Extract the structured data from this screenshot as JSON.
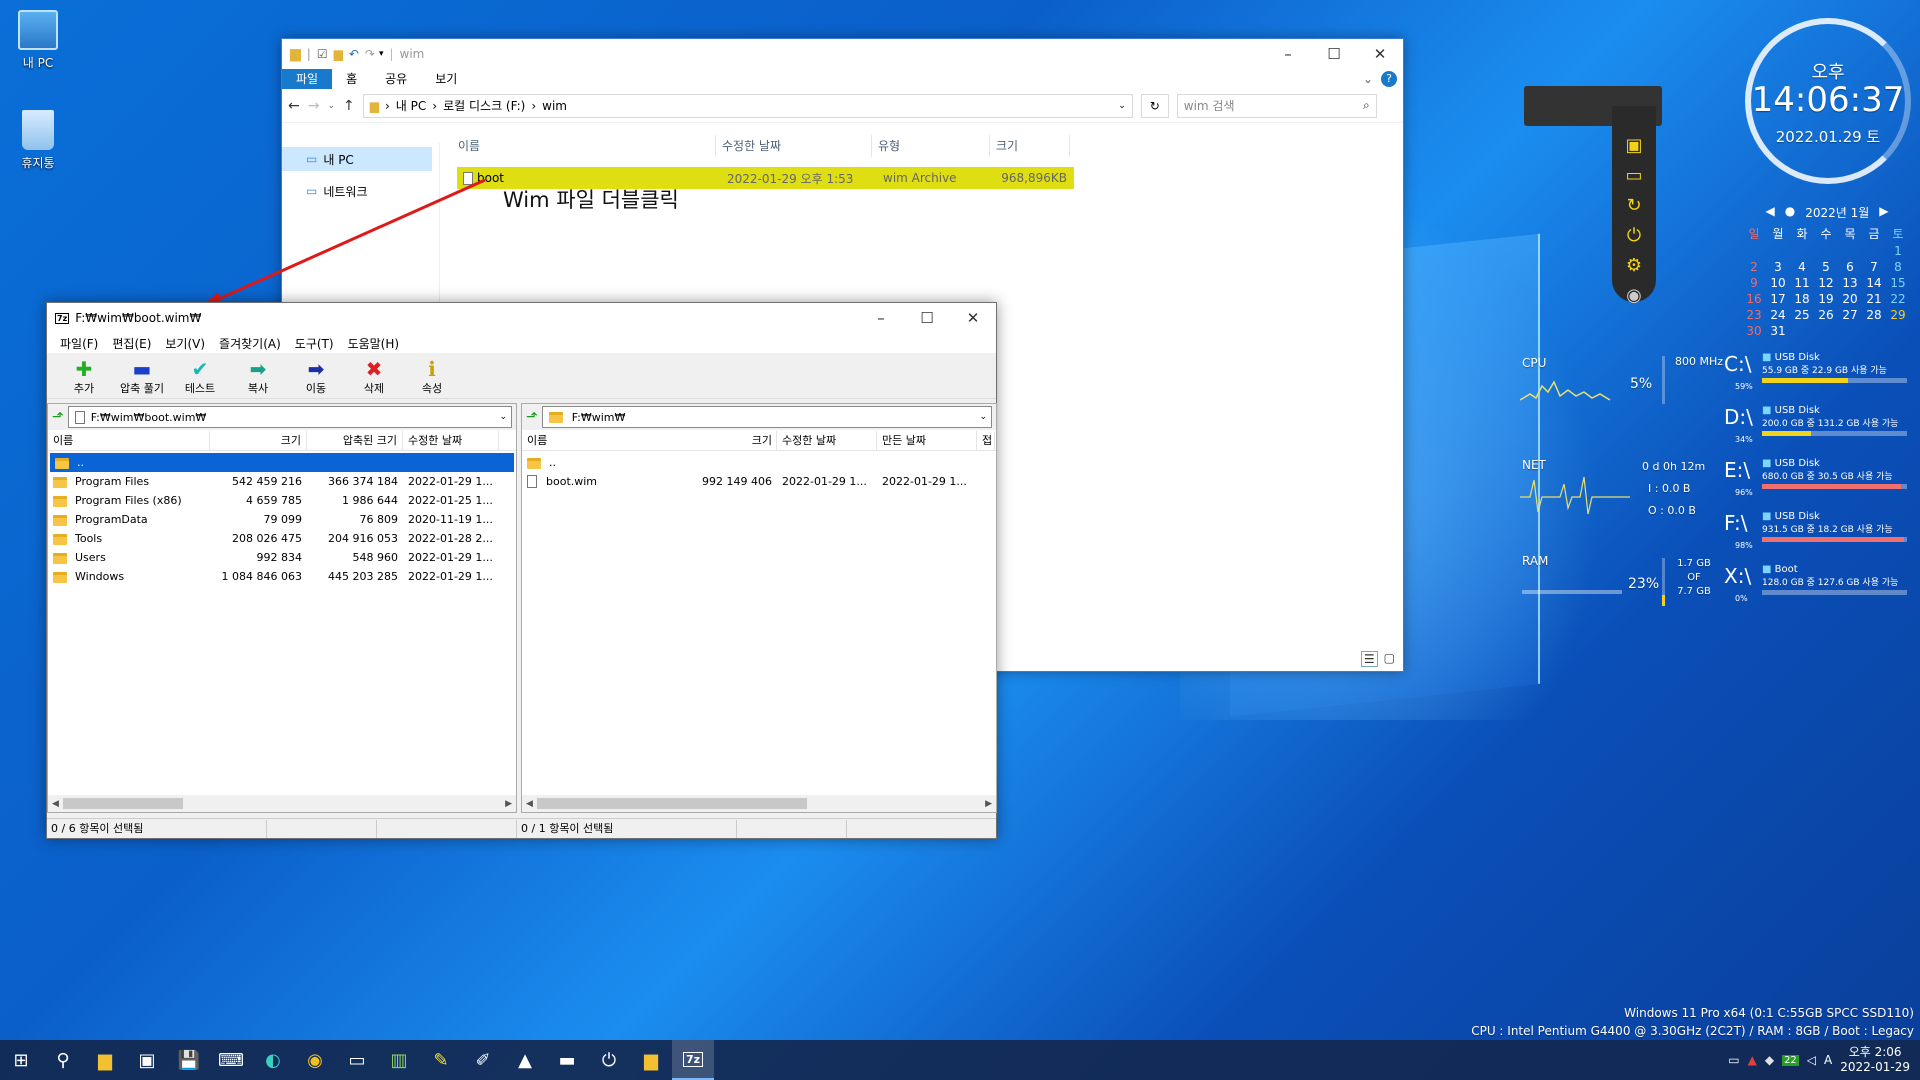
{
  "desktop": {
    "icons": [
      {
        "label": "내 PC"
      },
      {
        "label": "휴지통"
      }
    ]
  },
  "explorer": {
    "title": "wim",
    "tabs": [
      "파일",
      "홈",
      "공유",
      "보기"
    ],
    "breadcrumb": [
      "내 PC",
      "로컬 디스크 (F:)",
      "wim"
    ],
    "search_placeholder": "wim 검색",
    "nav": [
      "내 PC",
      "네트워크"
    ],
    "columns": [
      "이름",
      "수정한 날짜",
      "유형",
      "크기"
    ],
    "row": {
      "name": "boot",
      "modified": "2022-01-29 오후 1:53",
      "type": "wim Archive",
      "size": "968,896KB"
    }
  },
  "annotation": {
    "text": "Wim 파일 더블클릭"
  },
  "sevenzip": {
    "title": "F:₩wim₩boot.wim₩",
    "menu": [
      "파일(F)",
      "편집(E)",
      "보기(V)",
      "즐겨찾기(A)",
      "도구(T)",
      "도움말(H)"
    ],
    "tools": [
      {
        "label": "추가",
        "glyph": "✚"
      },
      {
        "label": "압축 풀기",
        "glyph": "▬"
      },
      {
        "label": "테스트",
        "glyph": "✔"
      },
      {
        "label": "복사",
        "glyph": "➡"
      },
      {
        "label": "이동",
        "glyph": "➡"
      },
      {
        "label": "삭제",
        "glyph": "✖"
      },
      {
        "label": "속성",
        "glyph": "ℹ"
      }
    ],
    "left": {
      "path": "F:₩wim₩boot.wim₩",
      "columns": [
        "이름",
        "크기",
        "압축된 크기",
        "수정한 날짜"
      ],
      "rows": [
        {
          "name": "..",
          "size": "",
          "packed": "",
          "modified": ""
        },
        {
          "name": "Program Files",
          "size": "542 459 216",
          "packed": "366 374 184",
          "modified": "2022-01-29 1..."
        },
        {
          "name": "Program Files (x86)",
          "size": "4 659 785",
          "packed": "1 986 644",
          "modified": "2022-01-25 1..."
        },
        {
          "name": "ProgramData",
          "size": "79 099",
          "packed": "76 809",
          "modified": "2020-11-19 1..."
        },
        {
          "name": "Tools",
          "size": "208 026 475",
          "packed": "204 916 053",
          "modified": "2022-01-28 2..."
        },
        {
          "name": "Users",
          "size": "992 834",
          "packed": "548 960",
          "modified": "2022-01-29 1..."
        },
        {
          "name": "Windows",
          "size": "1 084 846 063",
          "packed": "445 203 285",
          "modified": "2022-01-29 1..."
        }
      ],
      "status": "0 / 6 항목이 선택됨"
    },
    "right": {
      "path": "F:₩wim₩",
      "columns": [
        "이름",
        "크기",
        "수정한 날짜",
        "만든 날짜",
        "접"
      ],
      "rows": [
        {
          "name": "..",
          "size": "",
          "modified": "",
          "created": ""
        },
        {
          "name": "boot.wim",
          "size": "992 149 406",
          "modified": "2022-01-29 1...",
          "created": "2022-01-29 1..."
        }
      ],
      "status": "0 / 1 항목이 선택됨"
    }
  },
  "clock": {
    "ampm": "오후",
    "time": "14:06:37",
    "date": "2022.01.29 토"
  },
  "calendar": {
    "header": "2022년 1월",
    "weekdays": [
      "일",
      "월",
      "화",
      "수",
      "목",
      "금",
      "토"
    ],
    "days": [
      "",
      "",
      "",
      "",
      "",
      "",
      "1",
      "2",
      "3",
      "4",
      "5",
      "6",
      "7",
      "8",
      "9",
      "10",
      "11",
      "12",
      "13",
      "14",
      "15",
      "16",
      "17",
      "18",
      "19",
      "20",
      "21",
      "22",
      "23",
      "24",
      "25",
      "26",
      "27",
      "28",
      "29",
      "30",
      "31"
    ]
  },
  "monitor": {
    "cpu": {
      "label": "CPU",
      "value": "5%",
      "freq": "800 MHz"
    },
    "net": {
      "label": "NET",
      "uptime": "0 d 0h 12m",
      "in": "I : 0.0 B",
      "out": "O : 0.0 B"
    },
    "ram": {
      "label": "RAM",
      "value": "23%",
      "used": "1.7 GB",
      "of": "OF",
      "total": "7.7 GB"
    }
  },
  "drives": [
    {
      "letter": "C:\\",
      "pct": "59%",
      "name": "USB Disk",
      "detail": "55.9 GB 중  22.9 GB 사용 가능",
      "fill": 0.59,
      "color": "#f2d31a"
    },
    {
      "letter": "D:\\",
      "pct": "34%",
      "name": "USB Disk",
      "detail": "200.0 GB 중 131.2 GB 사용 가능",
      "fill": 0.34,
      "color": "#f2d31a"
    },
    {
      "letter": "E:\\",
      "pct": "96%",
      "name": "USB Disk",
      "detail": "680.0 GB 중 30.5 GB 사용 가능",
      "fill": 0.96,
      "color": "#f07070"
    },
    {
      "letter": "F:\\",
      "pct": "98%",
      "name": "USB Disk",
      "detail": "931.5 GB 중 18.2 GB 사용 가능",
      "fill": 0.98,
      "color": "#f07070"
    },
    {
      "letter": "X:\\",
      "pct": "0%",
      "name": "Boot",
      "detail": "128.0 GB 중 127.6 GB 사용 가능",
      "fill": 0.0,
      "color": "#f2d31a"
    }
  ],
  "sysinfo": {
    "line1": "Windows 11 Pro x64 (0:1 C:55GB SPCC SSD110)",
    "line2": "CPU : Intel Pentium G4400 @ 3.30GHz (2C2T) / RAM : 8GB / Boot : Legacy"
  },
  "taskbar": {
    "time": "오후 2:06",
    "date": "2022-01-29",
    "ime": "A",
    "battery": "22"
  }
}
